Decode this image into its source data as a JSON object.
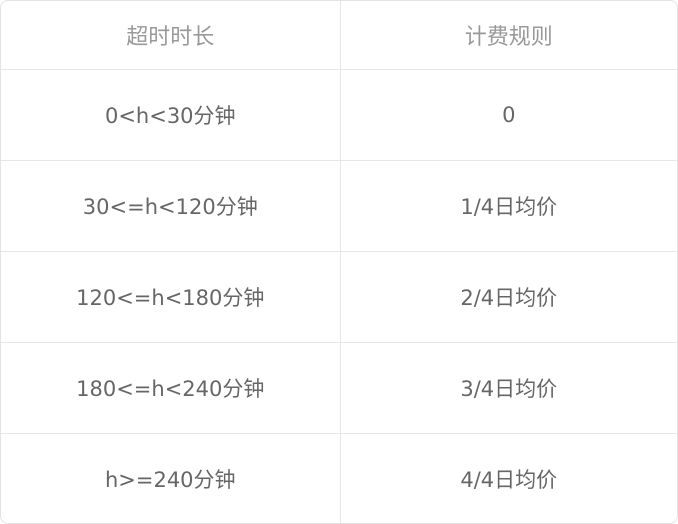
{
  "table": {
    "headers": [
      "超时时长",
      "计费规则"
    ],
    "rows": [
      [
        "0<h<30分钟",
        "0"
      ],
      [
        "30<=h<120分钟",
        "1/4日均价"
      ],
      [
        "120<=h<180分钟",
        "2/4日均价"
      ],
      [
        "180<=h<240分钟",
        "3/4日均价"
      ],
      [
        "h>=240分钟",
        "4/4日均价"
      ]
    ]
  }
}
